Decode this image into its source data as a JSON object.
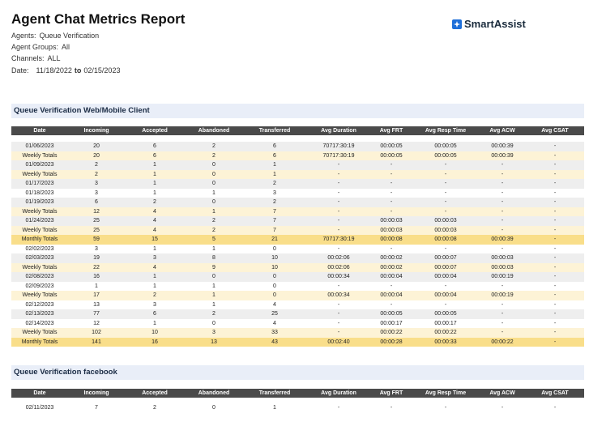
{
  "header": {
    "title": "Agent Chat Metrics Report",
    "agents_label": "Agents:",
    "agents_value": "Queue Verification",
    "groups_label": "Agent Groups:",
    "groups_value": "All",
    "channels_label": "Channels:",
    "channels_value": "ALL",
    "date_label": "Date:",
    "date_from": "11/18/2022",
    "date_to_word": "to",
    "date_to": "02/15/2023"
  },
  "logo": {
    "text": "SmartAssist",
    "icon": "smartassist-logo-icon",
    "color": "#1e6fd9"
  },
  "columns": [
    "Date",
    "Incoming",
    "Accepted",
    "Abandoned",
    "Transferred",
    "Avg Duration",
    "Avg FRT",
    "Avg Resp Time",
    "Avg ACW",
    "Avg CSAT"
  ],
  "sections": [
    {
      "title": "Queue Verification Web/Mobile Client",
      "rows": [
        {
          "kind": "alt",
          "cells": [
            "01/06/2023",
            "20",
            "6",
            "2",
            "6",
            "70717:30:19",
            "00:00:05",
            "00:00:05",
            "00:00:39",
            "-"
          ]
        },
        {
          "kind": "weekly",
          "cells": [
            "Weekly Totals",
            "20",
            "6",
            "2",
            "6",
            "70717:30:19",
            "00:00:05",
            "00:00:05",
            "00:00:39",
            "-"
          ]
        },
        {
          "kind": "alt",
          "cells": [
            "01/09/2023",
            "2",
            "1",
            "0",
            "1",
            "-",
            "-",
            "-",
            "-",
            "-"
          ]
        },
        {
          "kind": "weekly",
          "cells": [
            "Weekly Totals",
            "2",
            "1",
            "0",
            "1",
            "-",
            "-",
            "-",
            "-",
            "-"
          ]
        },
        {
          "kind": "alt",
          "cells": [
            "01/17/2023",
            "3",
            "1",
            "0",
            "2",
            "-",
            "-",
            "-",
            "-",
            "-"
          ]
        },
        {
          "kind": "plain",
          "cells": [
            "01/18/2023",
            "3",
            "1",
            "1",
            "3",
            "-",
            "-",
            "-",
            "-",
            "-"
          ]
        },
        {
          "kind": "alt",
          "cells": [
            "01/19/2023",
            "6",
            "2",
            "0",
            "2",
            "-",
            "-",
            "-",
            "-",
            "-"
          ]
        },
        {
          "kind": "weekly",
          "cells": [
            "Weekly Totals",
            "12",
            "4",
            "1",
            "7",
            "-",
            "-",
            "-",
            "-",
            "-"
          ]
        },
        {
          "kind": "alt",
          "cells": [
            "01/24/2023",
            "25",
            "4",
            "2",
            "7",
            "-",
            "00:00:03",
            "00:00:03",
            "-",
            "-"
          ]
        },
        {
          "kind": "weekly",
          "cells": [
            "Weekly Totals",
            "25",
            "4",
            "2",
            "7",
            "-",
            "00:00:03",
            "00:00:03",
            "-",
            "-"
          ]
        },
        {
          "kind": "monthly",
          "cells": [
            "Monthly Totals",
            "59",
            "15",
            "5",
            "21",
            "70717:30:19",
            "00:00:08",
            "00:00:08",
            "00:00:39",
            "-"
          ]
        },
        {
          "kind": "plain",
          "cells": [
            "02/02/2023",
            "3",
            "1",
            "1",
            "0",
            "-",
            "-",
            "-",
            "-",
            "-"
          ]
        },
        {
          "kind": "alt",
          "cells": [
            "02/03/2023",
            "19",
            "3",
            "8",
            "10",
            "00:02:06",
            "00:00:02",
            "00:00:07",
            "00:00:03",
            "-"
          ]
        },
        {
          "kind": "weekly",
          "cells": [
            "Weekly Totals",
            "22",
            "4",
            "9",
            "10",
            "00:02:06",
            "00:00:02",
            "00:00:07",
            "00:00:03",
            "-"
          ]
        },
        {
          "kind": "alt",
          "cells": [
            "02/08/2023",
            "16",
            "1",
            "0",
            "0",
            "00:00:34",
            "00:00:04",
            "00:00:04",
            "00:00:19",
            "-"
          ]
        },
        {
          "kind": "plain",
          "cells": [
            "02/09/2023",
            "1",
            "1",
            "1",
            "0",
            "-",
            "-",
            "-",
            "-",
            "-"
          ]
        },
        {
          "kind": "weekly",
          "cells": [
            "Weekly Totals",
            "17",
            "2",
            "1",
            "0",
            "00:00:34",
            "00:00:04",
            "00:00:04",
            "00:00:19",
            "-"
          ]
        },
        {
          "kind": "plain",
          "cells": [
            "02/12/2023",
            "13",
            "3",
            "1",
            "4",
            "-",
            "-",
            "-",
            "-",
            "-"
          ]
        },
        {
          "kind": "alt",
          "cells": [
            "02/13/2023",
            "77",
            "6",
            "2",
            "25",
            "-",
            "00:00:05",
            "00:00:05",
            "-",
            "-"
          ]
        },
        {
          "kind": "plain",
          "cells": [
            "02/14/2023",
            "12",
            "1",
            "0",
            "4",
            "-",
            "00:00:17",
            "00:00:17",
            "-",
            "-"
          ]
        },
        {
          "kind": "weekly",
          "cells": [
            "Weekly Totals",
            "102",
            "10",
            "3",
            "33",
            "-",
            "00:00:22",
            "00:00:22",
            "-",
            "-"
          ]
        },
        {
          "kind": "monthly",
          "cells": [
            "Monthly Totals",
            "141",
            "16",
            "13",
            "43",
            "00:02:40",
            "00:00:28",
            "00:00:33",
            "00:00:22",
            "-"
          ]
        }
      ]
    },
    {
      "title": "Queue Verification facebook",
      "rows": [
        {
          "kind": "plain",
          "cells": [
            "02/11/2023",
            "7",
            "2",
            "0",
            "1",
            "-",
            "-",
            "-",
            "-",
            "-"
          ]
        }
      ]
    }
  ]
}
